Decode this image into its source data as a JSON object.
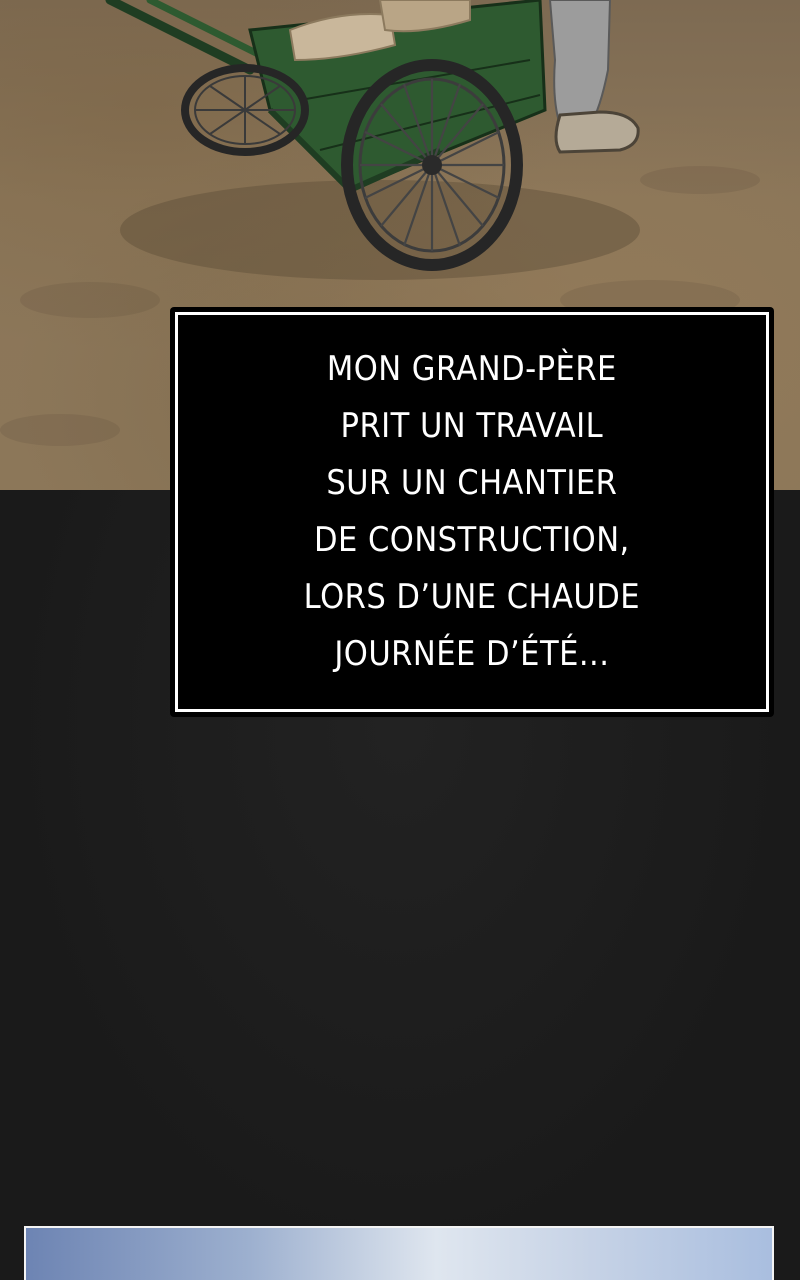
{
  "caption": {
    "lines": [
      "MON GRAND-PÈRE",
      "PRIT UN TRAVAIL",
      "SUR UN CHANTIER",
      "DE CONSTRUCTION,",
      "LORS D’UNE CHAUDE",
      "JOURNÉE D’ÉTÉ..."
    ]
  },
  "colors": {
    "ground": "#8b7659",
    "cart_green": "#2e5a30",
    "caption_bg": "#000000",
    "caption_border": "#ffffff",
    "dark_panel": "#1c1c1c",
    "sky": "#9db0cf"
  },
  "icons": [
    "green-wheelbarrow-cart",
    "worker-boots"
  ]
}
